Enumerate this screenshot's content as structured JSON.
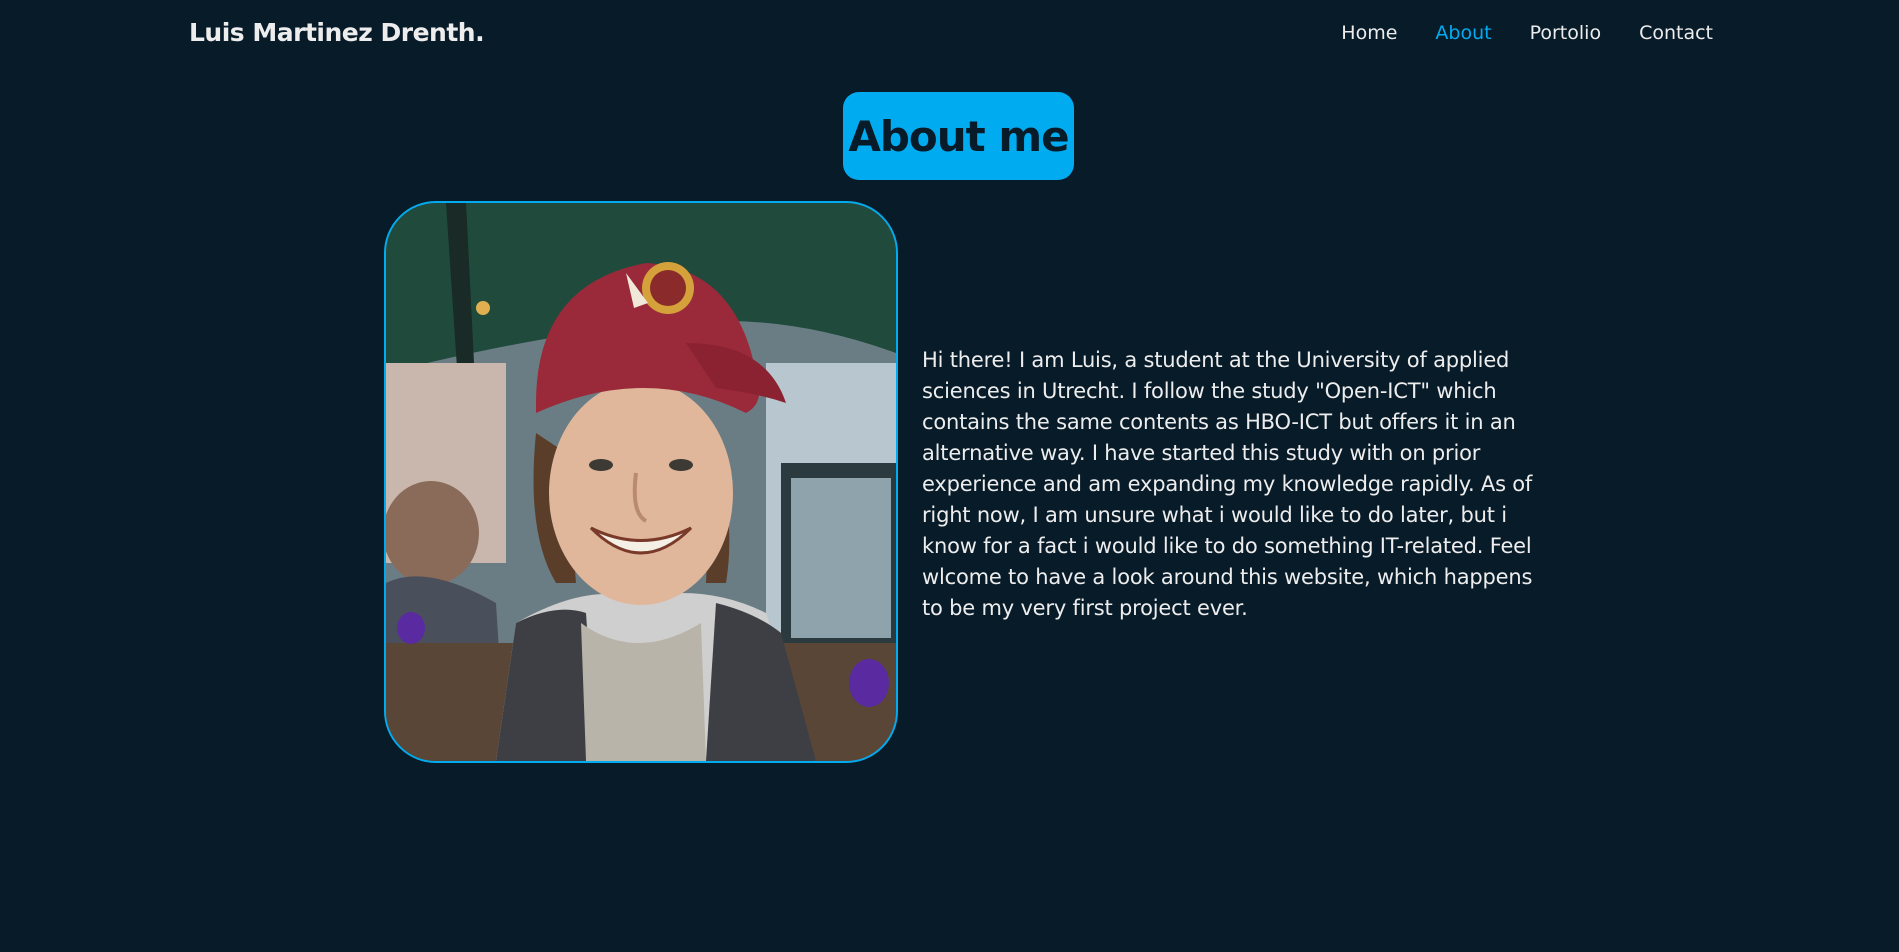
{
  "site": {
    "logo": "Luis Martinez Drenth."
  },
  "nav": {
    "items": [
      {
        "label": "Home"
      },
      {
        "label": "About"
      },
      {
        "label": "Portolio"
      },
      {
        "label": "Contact"
      }
    ],
    "active": "About"
  },
  "about": {
    "heading": "About me",
    "bio": "Hi there! I am Luis, a student at the University of applied sciences in Utrecht. I follow the study \"Open-ICT\" which contains the same contents as HBO-ICT but offers it in an alternative way. I have started this study with on prior experience and am expanding my knowledge rapidly. As of right now, I am unsure what i would like to do later, but i know for a fact i would like to do something IT-related. Feel wlcome to have a look around this website, which happens to be my very first project ever."
  },
  "colors": {
    "background": "#081b29",
    "accent": "#00abf0",
    "text": "#ededed"
  }
}
